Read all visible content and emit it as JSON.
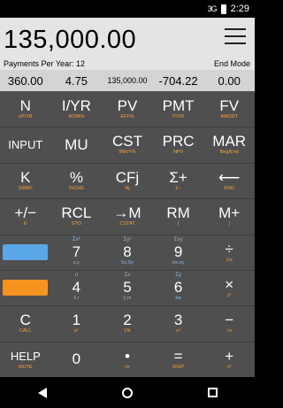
{
  "status_bar": {
    "signal": "3G",
    "time": "2:29"
  },
  "display": {
    "value": "135,000.00",
    "payments_label": "Payments Per Year: 12",
    "mode_label": "End Mode"
  },
  "registers": [
    "360.00",
    "4.75",
    "135,000.00",
    "-704.22",
    "0.00"
  ],
  "rows": [
    [
      {
        "name": "n-key",
        "main": "N",
        "sub": "xP/YR"
      },
      {
        "name": "iyr-key",
        "main": "I/YR",
        "sub": "NOM%"
      },
      {
        "name": "pv-key",
        "main": "PV",
        "sub": "EFF%"
      },
      {
        "name": "pmt-key",
        "main": "PMT",
        "sub": "P/YR"
      },
      {
        "name": "fv-key",
        "main": "FV",
        "sub": "AMORT"
      }
    ],
    [
      {
        "name": "input-key",
        "main": "INPUT",
        "sub": "",
        "sm": true
      },
      {
        "name": "mu-key",
        "main": "MU",
        "sub": ""
      },
      {
        "name": "cst-key",
        "main": "CST",
        "sub": "IRR/YR"
      },
      {
        "name": "prc-key",
        "main": "PRC",
        "sub": "NPV"
      },
      {
        "name": "mar-key",
        "main": "MAR",
        "sub": "Beg/End"
      }
    ],
    [
      {
        "name": "k-key",
        "main": "K",
        "sub": "SWAP"
      },
      {
        "name": "percent-key",
        "main": "%",
        "sub": "%CHG"
      },
      {
        "name": "cfj-key",
        "main": "CFj",
        "sub": "Nj"
      },
      {
        "name": "sigma-plus-key",
        "main": "Σ+",
        "sub": "Σ−"
      },
      {
        "name": "backspace-key",
        "main": "⟵",
        "sub": "RND"
      }
    ],
    [
      {
        "name": "plus-minus-key",
        "main": "+/−",
        "sub": "E"
      },
      {
        "name": "rcl-key",
        "main": "RCL",
        "sub": "STO"
      },
      {
        "name": "to-m-key",
        "main": "→M",
        "sub": "CSTAT"
      },
      {
        "name": "rm-key",
        "main": "RM",
        "sub": "("
      },
      {
        "name": "m-plus-key",
        "main": "M+",
        "sub": ")"
      }
    ],
    [
      {
        "name": "shift-blue-key",
        "shift": "blue"
      },
      {
        "name": "seven-key",
        "top": "Σx²",
        "main": "7",
        "sub": "x,y",
        "subBlue": true
      },
      {
        "name": "eight-key",
        "top": "Σy²",
        "main": "8",
        "sub": "Sx,Sy",
        "subBlue": true
      },
      {
        "name": "nine-key",
        "top": "Σxy",
        "main": "9",
        "sub": "σx,σy",
        "subBlue": true
      },
      {
        "name": "divide-key",
        "top": "",
        "main": "÷",
        "sub": "1/x"
      }
    ],
    [
      {
        "name": "shift-orange-key",
        "shift": "orange"
      },
      {
        "name": "four-key",
        "top": "n",
        "main": "4",
        "sub": "x̂,r",
        "subBlue": true
      },
      {
        "name": "five-key",
        "top": "Σx",
        "main": "5",
        "sub": "ŷ,m",
        "subBlue": true
      },
      {
        "name": "six-key",
        "top": "Σy",
        "main": "6",
        "sub": "x̄w",
        "subBlue": true
      },
      {
        "name": "multiply-key",
        "top": "",
        "main": "×",
        "sub": "yˣ"
      }
    ],
    [
      {
        "name": "c-key",
        "main": "C",
        "sub": "CALL"
      },
      {
        "name": "one-key",
        "main": "1",
        "sub": "eˣ"
      },
      {
        "name": "two-key",
        "main": "2",
        "sub": "LN"
      },
      {
        "name": "three-key",
        "main": "3",
        "sub": "n!"
      },
      {
        "name": "minus-key",
        "main": "−",
        "sub": "√x"
      }
    ],
    [
      {
        "name": "help-key",
        "main": "HELP",
        "sub": "MUTE",
        "sm": true
      },
      {
        "name": "zero-key",
        "main": "0",
        "sub": ""
      },
      {
        "name": "decimal-key",
        "main": "•",
        "sub": "•/•"
      },
      {
        "name": "equals-key",
        "main": "=",
        "sub": "DISP"
      },
      {
        "name": "plus-key",
        "main": "+",
        "sub": "x²"
      }
    ]
  ]
}
